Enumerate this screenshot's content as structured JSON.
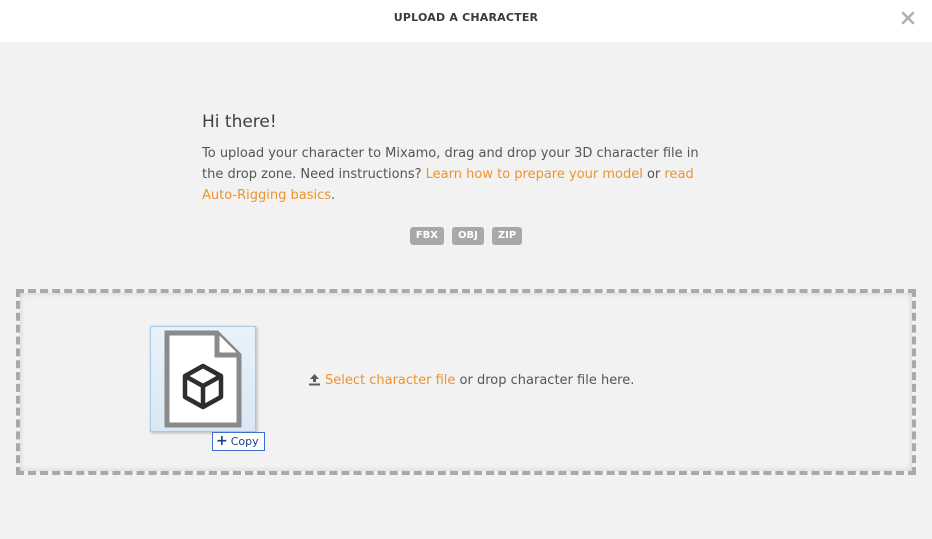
{
  "header": {
    "title": "UPLOAD A CHARACTER",
    "close_icon": "close-icon"
  },
  "intro": {
    "greeting": "Hi there!",
    "text_before": "To upload your character to Mixamo, drag and drop your 3D character file in the drop zone. Need instructions? ",
    "link_prepare": "Learn how to prepare your model",
    "text_or": " or ",
    "link_basics": "read Auto-Rigging basics",
    "text_end": "."
  },
  "formats": [
    "FBX",
    "OBJ",
    "ZIP"
  ],
  "dropzone": {
    "select_link": "Select character file",
    "drop_text": " or drop character file here.",
    "upload_icon": "upload-icon",
    "drag_preview_icon": "3d-file-icon",
    "copy_label": "Copy"
  },
  "colors": {
    "accent": "#f0932a",
    "badge": "#a8a8a8",
    "background": "#f2f2f2"
  }
}
